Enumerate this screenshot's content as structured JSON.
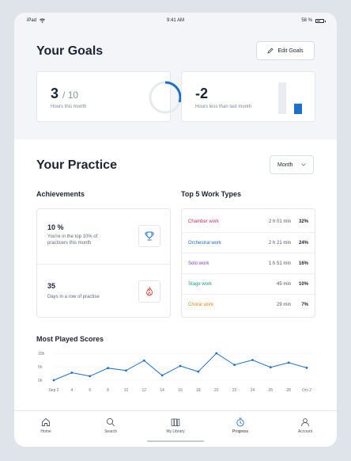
{
  "status_bar": {
    "device": "iPad",
    "time": "9:41 AM",
    "battery": "58 %"
  },
  "goals": {
    "title": "Your Goals",
    "edit_label": "Edit Goals",
    "hours_card": {
      "value": "3",
      "target": "/ 10",
      "caption": "Hours this month",
      "progress_fraction": 0.3
    },
    "diff_card": {
      "value": "-2",
      "caption": "Hours less than last month",
      "last_month_hours": 5,
      "this_month_hours": 3
    }
  },
  "practice": {
    "title": "Your Practice",
    "period_select": "Month",
    "achievements": {
      "title": "Achievements",
      "items": [
        {
          "value": "10 %",
          "description": "You're in the top 10% of practicers this month",
          "icon": "trophy-icon"
        },
        {
          "value": "35",
          "description": "Days in a row of practise",
          "icon": "flame-icon"
        }
      ]
    },
    "work_types": {
      "title": "Top 5 Work Types",
      "rows": [
        {
          "name": "Chamber work",
          "duration": "2 h 01 min",
          "percent": "32%",
          "color": "#c8325a"
        },
        {
          "name": "Orchestral work",
          "duration": "2 h 21 min",
          "percent": "24%",
          "color": "#1f6fc5"
        },
        {
          "name": "Solo work",
          "duration": "1 h 51 min",
          "percent": "16%",
          "color": "#7b3fbf"
        },
        {
          "name": "Stage work",
          "duration": "45 min",
          "percent": "10%",
          "color": "#1d9a8a"
        },
        {
          "name": "Choral work",
          "duration": "29 min",
          "percent": "7%",
          "color": "#e58a12"
        }
      ]
    }
  },
  "most_played": {
    "title": "Most Played Scores"
  },
  "chart_data": {
    "type": "line",
    "title": "Most Played Scores",
    "xlabel": "",
    "ylabel": "",
    "y_tick_labels": [
      "10h",
      "5h",
      "0h"
    ],
    "ylim": [
      0,
      10
    ],
    "x_tick_labels": [
      "Sep 2",
      "4",
      "6",
      "8",
      "10",
      "12",
      "14",
      "16",
      "18",
      "20",
      "22",
      "24",
      "26",
      "28",
      "Oct 2"
    ],
    "grid": true,
    "series": [
      {
        "values": [
          0,
          2.8,
          1.5,
          4.5,
          3.6,
          7.3,
          1.8,
          5.3,
          3.2,
          10,
          5.7,
          7.5,
          4.8,
          6.5,
          4.6
        ],
        "color": "#1f6fc5"
      }
    ]
  },
  "tabs": [
    {
      "label": "Home",
      "icon": "home-icon"
    },
    {
      "label": "Search",
      "icon": "search-icon"
    },
    {
      "label": "My Library",
      "icon": "library-icon"
    },
    {
      "label": "Progress",
      "icon": "timer-icon",
      "active": true
    },
    {
      "label": "Account",
      "icon": "account-icon"
    }
  ]
}
